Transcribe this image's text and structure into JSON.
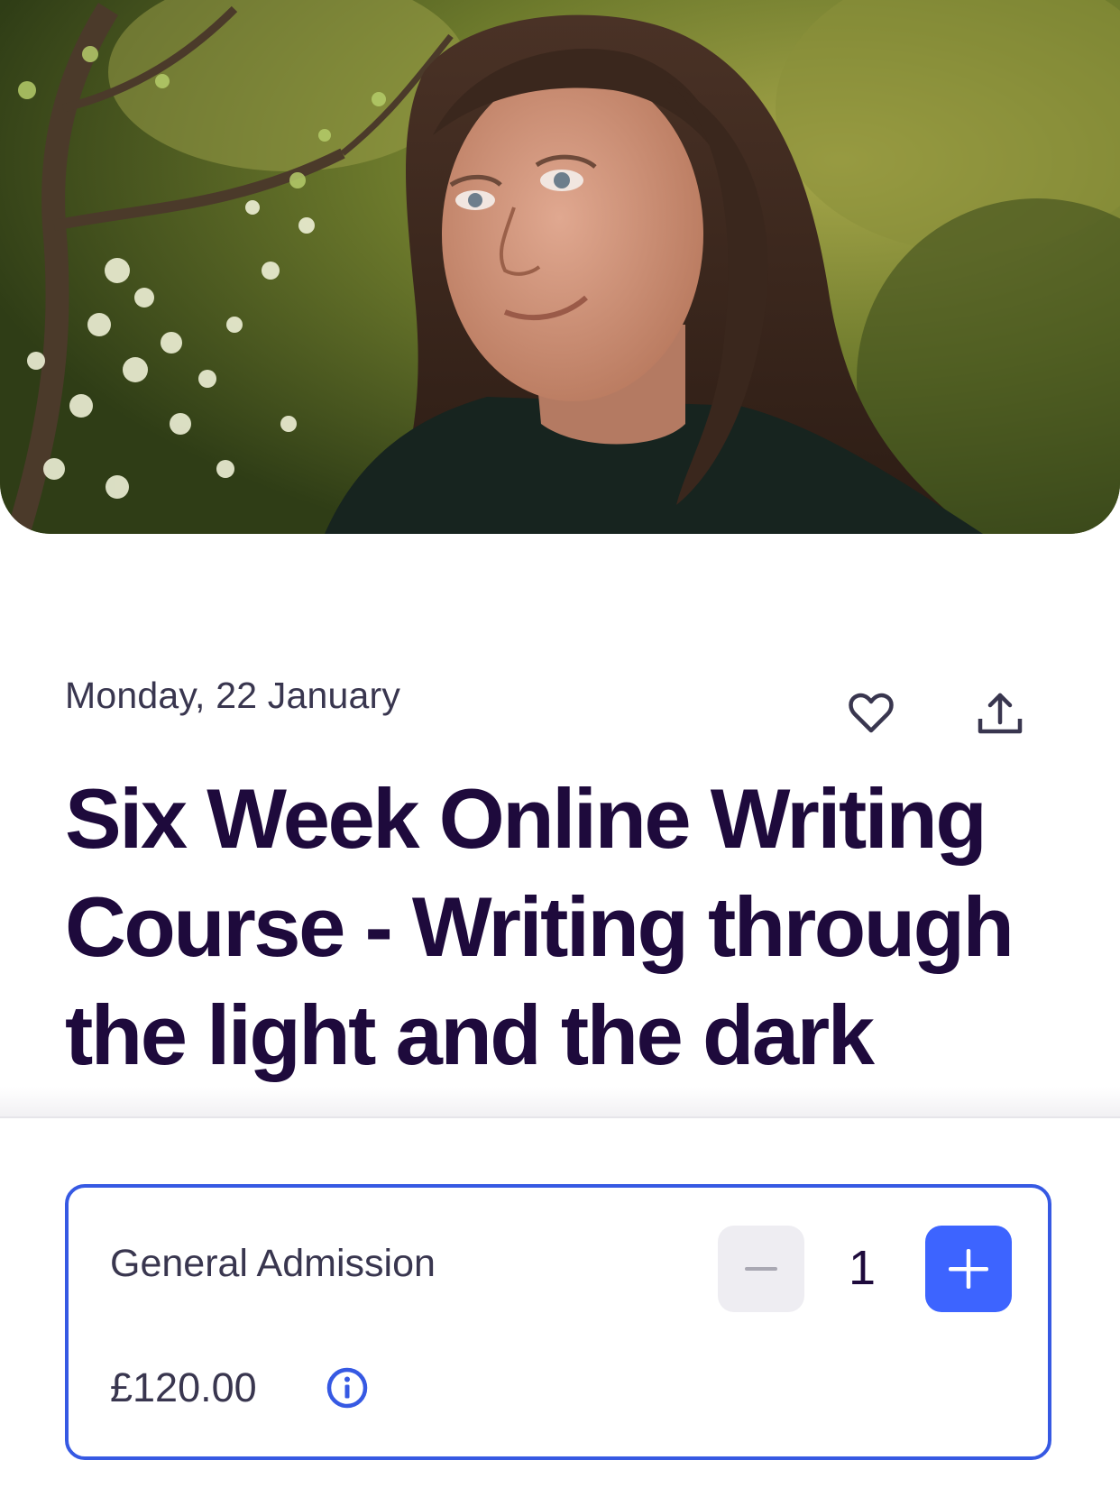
{
  "hero": {
    "image_description_icon": "event-photo"
  },
  "event": {
    "date": "Monday, 22 January",
    "title": "Six Week Online Writing Course - Writing through the light and the dark",
    "like_icon": "heart-icon",
    "share_icon": "share-upload-icon"
  },
  "ticket": {
    "name": "General Admission",
    "price": "£120.00",
    "quantity": "1",
    "info_icon": "info-icon",
    "minus_icon": "minus-icon",
    "plus_icon": "plus-icon"
  },
  "colors": {
    "title": "#1e0a3c",
    "text": "#39364f",
    "accent": "#3d64ff",
    "card_border": "#3659e3",
    "stepper_disabled": "#eeedf2"
  }
}
